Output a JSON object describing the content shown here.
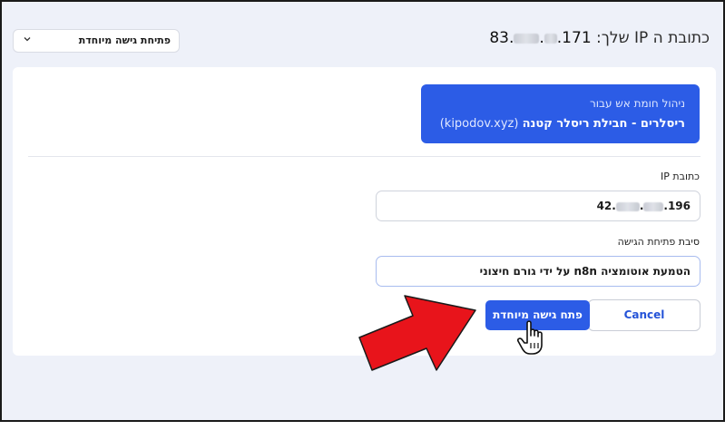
{
  "header": {
    "ip_label": "כתובת ה IP שלך:",
    "ip_part1": "83.",
    "ip_part2": ".",
    "ip_part3": ".171"
  },
  "dropdown": {
    "label": "פתיחת גישה מיוחדת",
    "icon": "chevron-down-icon"
  },
  "banner": {
    "title": "ניהול חומת אש עבור",
    "name": "ריסלרים - חבילת ריסלר קטנה",
    "domain": "(kipodov.xyz)"
  },
  "form": {
    "ip_label": "כתובת IP",
    "ip_part1": "42.",
    "ip_part2": ".",
    "ip_part3": ".196",
    "reason_label": "סיבת פתיחת הגישה",
    "reason_value": "הטמעת אוטומציה n8n על ידי גורם חיצוני"
  },
  "buttons": {
    "cancel": "Cancel",
    "open": "פתח גישה מיוחדת"
  },
  "colors": {
    "accent": "#2c5ce6",
    "background": "#eef1f9",
    "arrow": "#e8141b"
  }
}
